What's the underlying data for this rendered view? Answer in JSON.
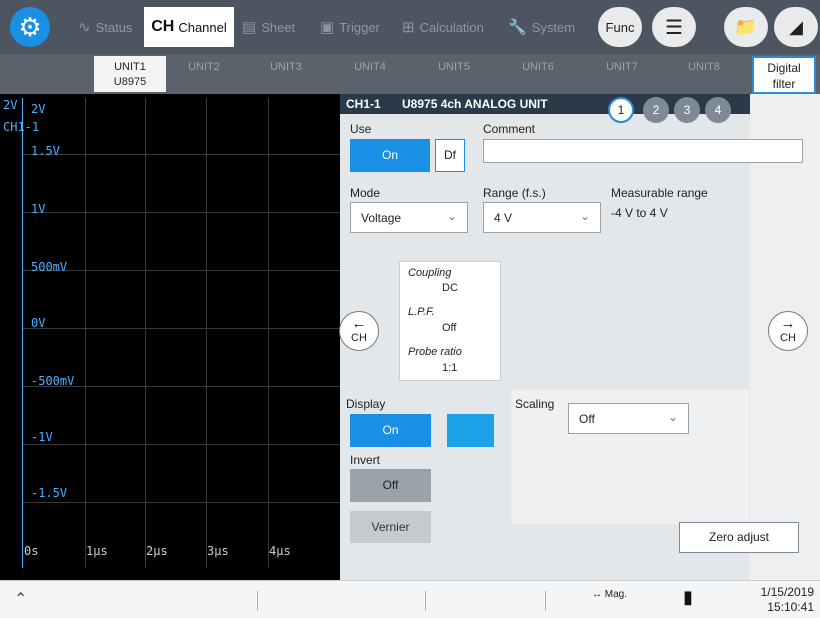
{
  "topbar": {
    "nav": [
      {
        "label": "Status",
        "icon": "waveform-icon"
      },
      {
        "label": "Channel",
        "prefix": "CH",
        "active": true
      },
      {
        "label": "Sheet",
        "icon": "sheet-icon"
      },
      {
        "label": "Trigger",
        "icon": "trigger-icon"
      },
      {
        "label": "Calculation",
        "icon": "calculator-icon"
      },
      {
        "label": "System",
        "icon": "wrench-icon"
      }
    ],
    "func_label": "Func"
  },
  "units": [
    {
      "label": "UNIT1",
      "model": "U8975",
      "active": true
    },
    {
      "label": "UNIT2"
    },
    {
      "label": "UNIT3"
    },
    {
      "label": "UNIT4"
    },
    {
      "label": "UNIT5"
    },
    {
      "label": "UNIT6"
    },
    {
      "label": "UNIT7"
    },
    {
      "label": "UNIT8"
    }
  ],
  "digital_filter": {
    "line1": "Digital",
    "line2": "filter"
  },
  "waveform": {
    "title": "2V",
    "channel": "CH1-1",
    "y_labels": [
      "2V",
      "1.5V",
      "1V",
      "500mV",
      "0V",
      "-500mV",
      "-1V",
      "-1.5V"
    ],
    "x_labels": [
      "0s",
      "1μs",
      "2μs",
      "3μs",
      "4μs"
    ]
  },
  "panel": {
    "ch": "CH1-1",
    "unit_name": "U8975 4ch ANALOG UNIT",
    "channels": [
      "1",
      "2",
      "3",
      "4"
    ],
    "use_label": "Use",
    "use_value": "On",
    "df_label": "Df",
    "comment_label": "Comment",
    "comment_value": "",
    "mode_label": "Mode",
    "mode_value": "Voltage",
    "range_label": "Range (f.s.)",
    "range_value": "4 V",
    "measurable_label": "Measurable range",
    "measurable_value": "-4 V to 4 V",
    "coupling_label": "Coupling",
    "coupling_value": "DC",
    "lpf_label": "L.P.F.",
    "lpf_value": "Off",
    "probe_label": "Probe ratio",
    "probe_value": "1:1",
    "prev_ch": "CH",
    "next_ch": "CH",
    "display_label": "Display",
    "display_value": "On",
    "display_color": "#1aa3e8",
    "invert_label": "Invert",
    "invert_value": "Off",
    "vernier_label": "Vernier",
    "scaling_label": "Scaling",
    "scaling_value": "Off",
    "zero_adjust_label": "Zero adjust"
  },
  "bottombar": {
    "mag_label": "Mag.",
    "date": "1/15/2019",
    "time": "15:10:41"
  }
}
